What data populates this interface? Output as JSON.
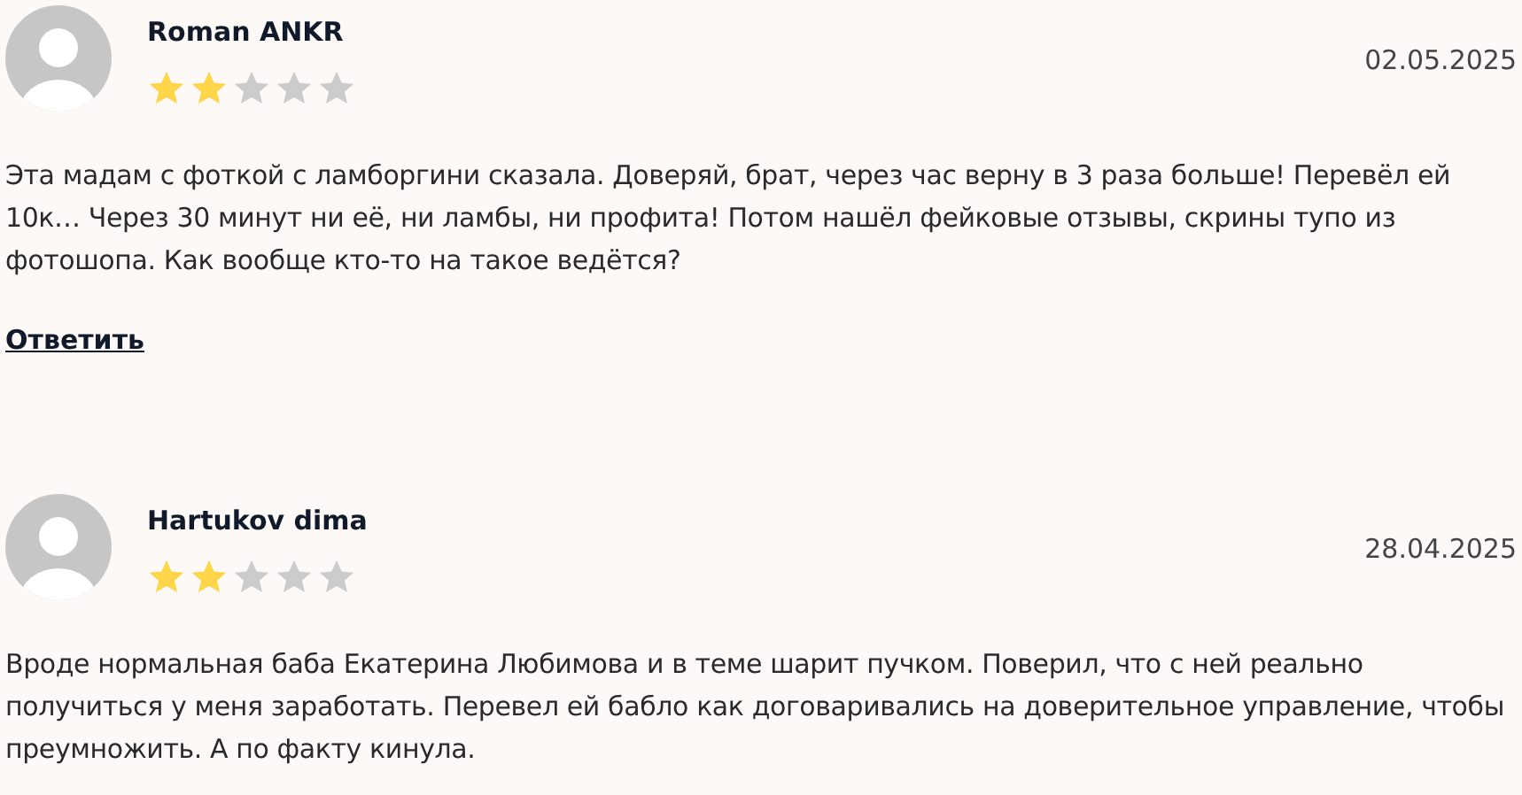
{
  "reviews": [
    {
      "author": "Roman ANKR",
      "stars": 2,
      "date": "02.05.2025",
      "text": "Эта мадам с фоткой с ламборгини сказала. Доверяй, брат, через час верну в 3 раза больше! Перевёл ей 10к… Через 30 минут ни её, ни ламбы, ни профита! Потом нашёл фейковые отзывы, скрины тупо из фотошопа. Как вообще кто-то на такое ведётся?",
      "reply": "Ответить"
    },
    {
      "author": "Hartukov dima",
      "stars": 2,
      "date": "28.04.2025",
      "text": "Вроде нормальная баба Екатерина Любимова и в теме шарит пучком. Поверил, что с ней реально получиться у меня заработать. Перевел ей бабло как договаривались на доверительное управление, чтобы преумножить. А по факту кинула."
    }
  ]
}
